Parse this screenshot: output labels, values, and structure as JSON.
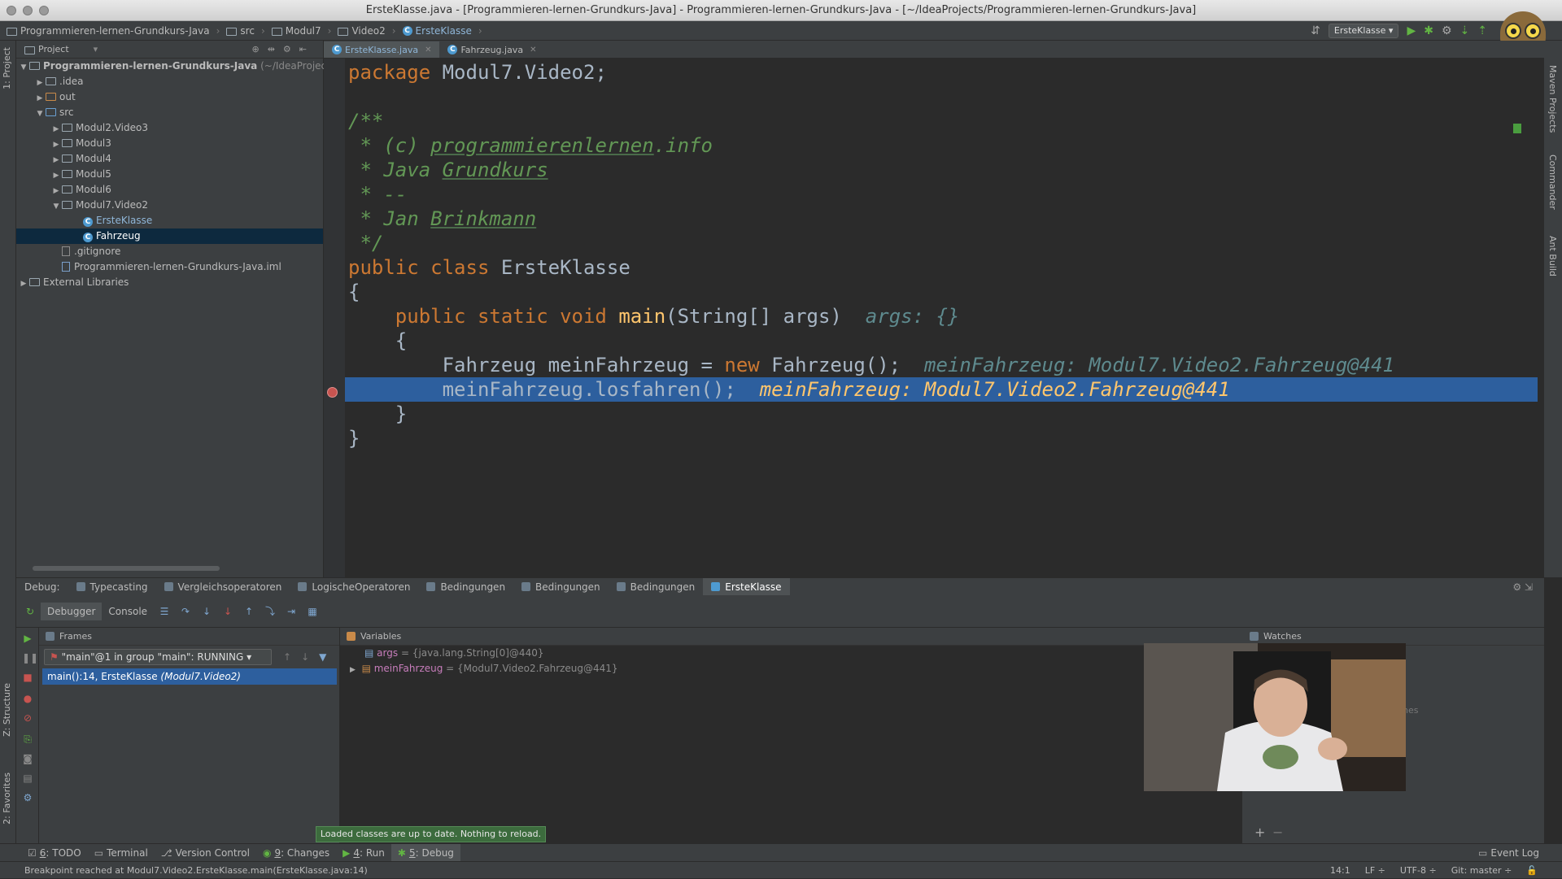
{
  "window": {
    "title": "ErsteKlasse.java - [Programmieren-lernen-Grundkurs-Java] - Programmieren-lernen-Grundkurs-Java - [~/IdeaProjects/Programmieren-lernen-Grundkurs-Java]"
  },
  "breadcrumb": [
    "Programmieren-lernen-Grundkurs-Java",
    "src",
    "Modul7",
    "Video2",
    "ErsteKlasse"
  ],
  "run_config": "ErsteKlasse",
  "left_tabs": {
    "project": "1: Project",
    "structure": "Z: Structure",
    "favorites": "2: Favorites"
  },
  "right_tabs": {
    "maven": "Maven Projects",
    "commander": "Commander",
    "ant": "Ant Build"
  },
  "project_panel": {
    "header": "Project",
    "root": "Programmieren-lernen-Grundkurs-Java",
    "root_path": "(~/IdeaProject",
    "items": [
      {
        "label": ".idea"
      },
      {
        "label": "out"
      },
      {
        "label": "src"
      },
      {
        "label": "Modul2.Video3"
      },
      {
        "label": "Modul3"
      },
      {
        "label": "Modul4"
      },
      {
        "label": "Modul5"
      },
      {
        "label": "Modul6"
      },
      {
        "label": "Modul7.Video2"
      },
      {
        "label": "ErsteKlasse"
      },
      {
        "label": "Fahrzeug"
      },
      {
        "label": ".gitignore"
      },
      {
        "label": "Programmieren-lernen-Grundkurs-Java.iml"
      },
      {
        "label": "External Libraries"
      }
    ]
  },
  "editor_tabs": [
    {
      "label": "ErsteKlasse.java"
    },
    {
      "label": "Fahrzeug.java"
    }
  ],
  "code": {
    "l1_kw": "package",
    "l1_rest": " Modul7.Video2;",
    "l3": "/**",
    "l4_a": " * (c) ",
    "l4_b": "programmierenlernen",
    "l4_c": ".info",
    "l5_a": " * Java ",
    "l5_b": "Grundkurs",
    "l6": " * --",
    "l7_a": " * Jan ",
    "l7_b": "Brinkmann",
    "l8": " */",
    "l9_kw": "public class",
    "l9_rest": " ErsteKlasse",
    "l10": "{",
    "l11_kw": "    public static void",
    "l11_fn": " main",
    "l11_rest": "(String[] args)",
    "l11_hint": "  args: {}",
    "l12": "    {",
    "l13_a": "        Fahrzeug meinFahrzeug = ",
    "l13_kw": "new",
    "l13_b": " Fahrzeug();",
    "l13_hint": "  meinFahrzeug: Modul7.Video2.Fahrzeug@441",
    "l14_a": "        meinFahrzeug.losfahren();",
    "l14_hint": "  meinFahrzeug: Modul7.Video2.Fahrzeug@441",
    "l15": "    }",
    "l16": "}"
  },
  "debug": {
    "label": "Debug:",
    "tabs": [
      "Typecasting",
      "Vergleichsoperatoren",
      "LogischeOperatoren",
      "Bedingungen",
      "Bedingungen",
      "Bedingungen",
      "ErsteKlasse"
    ],
    "subtabs": [
      "Debugger",
      "Console"
    ],
    "frames_title": "Frames",
    "thread": "\"main\"@1 in group \"main\": RUNNING",
    "frame_main": "main():14, ErsteKlasse ",
    "frame_pkg": "(Modul7.Video2)",
    "variables_title": "Variables",
    "vars": [
      {
        "name": "args",
        "value": " = {java.lang.String[0]@440}"
      },
      {
        "name": "meinFahrzeug",
        "value": " = {Modul7.Video2.Fahrzeug@441}"
      }
    ],
    "watches_title": "Watches",
    "watches_partial": "hes"
  },
  "notification": "Loaded classes are up to date. Nothing to reload.",
  "bottom_tabs": [
    {
      "num": "6",
      "label": ": TODO"
    },
    {
      "num": "",
      "label": "Terminal"
    },
    {
      "num": "",
      "label": "Version Control"
    },
    {
      "num": "9",
      "label": ": Changes"
    },
    {
      "num": "4",
      "label": ": Run"
    },
    {
      "num": "5",
      "label": ": Debug"
    }
  ],
  "event_log": "Event Log",
  "status": {
    "message": "Breakpoint reached at Modul7.Video2.ErsteKlasse.main(ErsteKlasse.java:14)",
    "position": "14:1",
    "line_sep": "LF ÷",
    "encoding": "UTF-8 ÷",
    "vcs": "Git: master ÷"
  }
}
